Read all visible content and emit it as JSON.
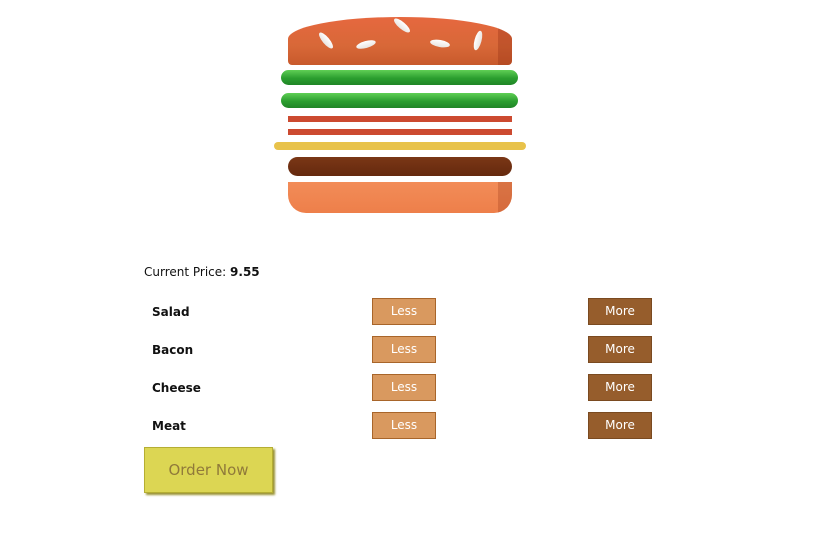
{
  "price": {
    "label": "Current Price:",
    "value": "9.55"
  },
  "ingredients": [
    {
      "name": "Salad",
      "less_label": "Less",
      "more_label": "More"
    },
    {
      "name": "Bacon",
      "less_label": "Less",
      "more_label": "More"
    },
    {
      "name": "Cheese",
      "less_label": "Less",
      "more_label": "More"
    },
    {
      "name": "Meat",
      "less_label": "Less",
      "more_label": "More"
    }
  ],
  "order_button": "Order Now",
  "colors": {
    "bun": "#e66c3d",
    "lettuce": "#2b9e2f",
    "bacon": "#cc4a30",
    "cheese": "#e8c24a",
    "meat": "#6e2e10",
    "less_button": "#d9995f",
    "more_button": "#965d2c",
    "order_button": "#dcd653"
  }
}
